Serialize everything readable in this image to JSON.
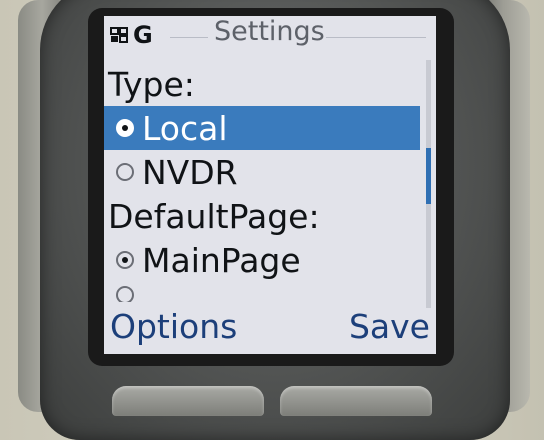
{
  "status": {
    "signal_label": "G",
    "icon": "network-icon"
  },
  "title": "Settings",
  "sections": [
    {
      "heading": "Type:",
      "options": [
        {
          "label": "Local",
          "checked": true,
          "highlighted": true
        },
        {
          "label": "NVDR",
          "checked": false,
          "highlighted": false
        }
      ]
    },
    {
      "heading": "DefaultPage:",
      "options": [
        {
          "label": "MainPage",
          "checked": true,
          "highlighted": false
        }
      ]
    }
  ],
  "softkeys": {
    "left": "Options",
    "right": "Save"
  },
  "colors": {
    "highlight": "#3a7bbd",
    "softkey_text": "#1c3f7a",
    "screen_bg": "#e2e3ea"
  }
}
